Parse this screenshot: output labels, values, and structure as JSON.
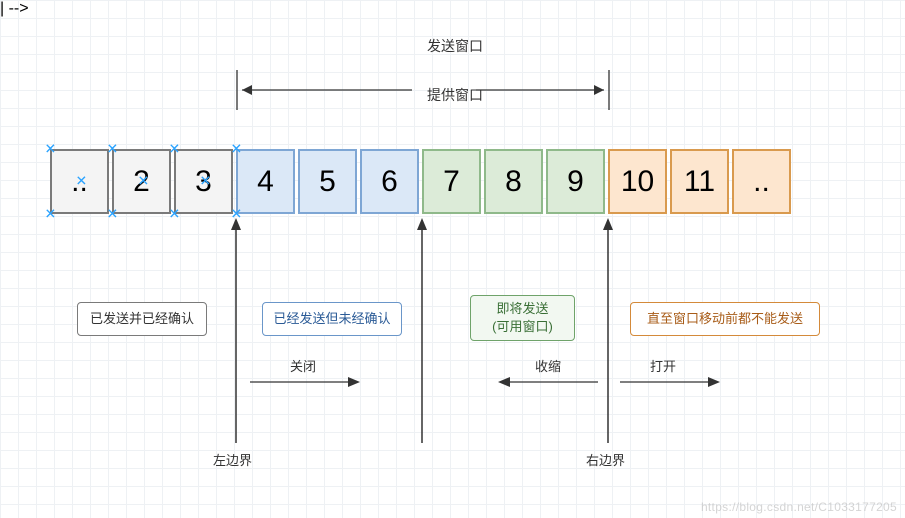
{
  "chart_data": {
    "type": "table",
    "title": "TCP 发送窗口 / 滑动窗口示意图",
    "sequence": [
      "..",
      "2",
      "3",
      "4",
      "5",
      "6",
      "7",
      "8",
      "9",
      "10",
      "11",
      ".."
    ],
    "groups": [
      {
        "name": "已发送并已经确认",
        "color": "#f4f4f4",
        "indices": [
          0,
          1,
          2
        ]
      },
      {
        "name": "已经发送但未经确认",
        "color": "#dbe8f7",
        "indices": [
          3,
          4,
          5
        ]
      },
      {
        "name": "即将发送 (可用窗口)",
        "color": "#dcebd8",
        "indices": [
          6,
          7,
          8
        ]
      },
      {
        "name": "直至窗口移动前都不能发送",
        "color": "#fde6cf",
        "indices": [
          9,
          10,
          11
        ]
      }
    ],
    "windows": {
      "offered_window": {
        "label": "提供窗口",
        "range_seq": [
          4,
          9
        ]
      },
      "send_window_label": "发送窗口"
    },
    "boundaries": {
      "left": "左边界",
      "right": "右边界"
    },
    "movements": {
      "close": "关闭",
      "shrink": "收缩",
      "open": "打开"
    }
  },
  "top": {
    "send_window": "发送窗口",
    "offered_window": "提供窗口"
  },
  "cells": [
    "..",
    "2",
    "3",
    "4",
    "5",
    "6",
    "7",
    "8",
    "9",
    "10",
    "11",
    ".."
  ],
  "legend": {
    "gray": "已发送并已经确认",
    "blue": "已经发送但未经确认",
    "green_l1": "即将发送",
    "green_l2": "(可用窗口)",
    "orange": "直至窗口移动前都不能发送"
  },
  "labels": {
    "close": "关闭",
    "shrink": "收缩",
    "open": "打开",
    "left_boundary": "左边界",
    "right_boundary": "右边界"
  },
  "watermark": "https://blog.csdn.net/C1033177205"
}
